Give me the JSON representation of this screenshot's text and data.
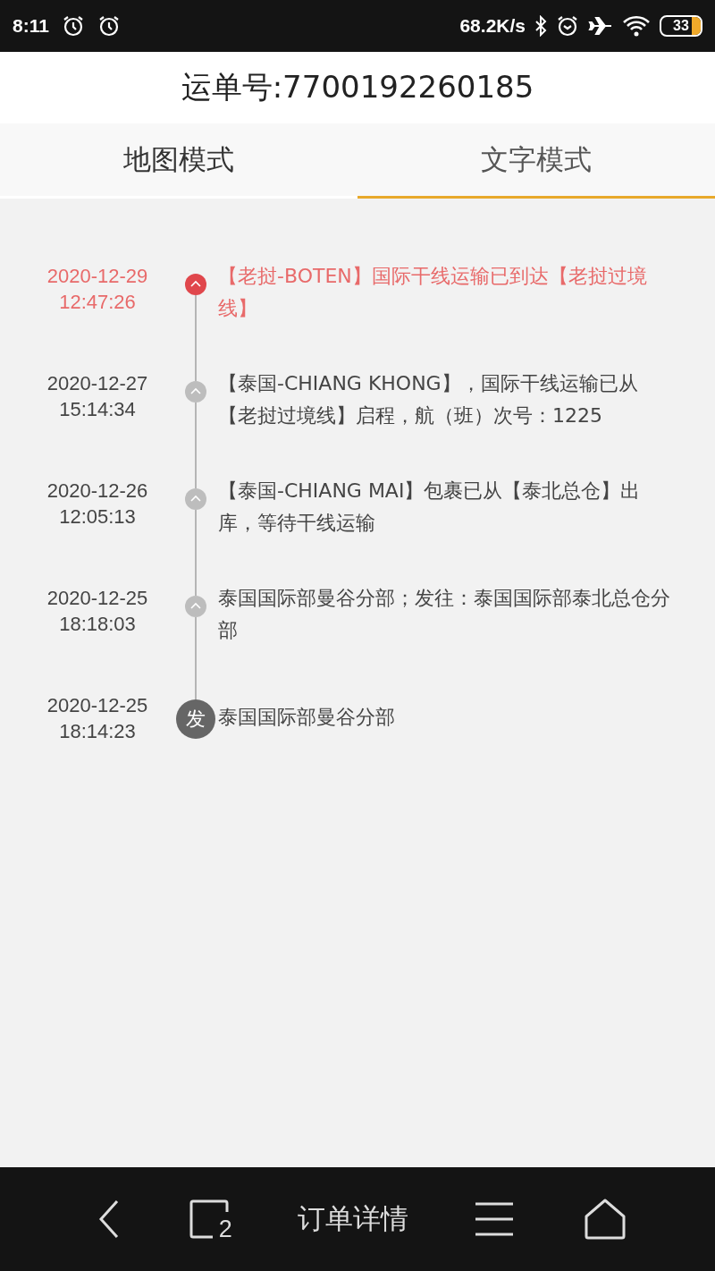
{
  "status_bar": {
    "time": "8:11",
    "speed": "68.2K/s",
    "battery": "33"
  },
  "header": {
    "title": "运单号:7700192260185"
  },
  "tabs": [
    {
      "label": "地图模式",
      "selected": false
    },
    {
      "label": "文字模式",
      "selected": true
    }
  ],
  "timeline": [
    {
      "kind": "latest",
      "date": "2020-12-29",
      "time": "12:47:26",
      "text": "【老挝-BOTEN】国际干线运输已到达【老挝过境线】"
    },
    {
      "kind": "transit",
      "date": "2020-12-27",
      "time": "15:14:34",
      "text": "【泰国-CHIANG KHONG】，国际干线运输已从【老挝过境线】启程，航（班）次号：1225"
    },
    {
      "kind": "transit",
      "date": "2020-12-26",
      "time": "12:05:13",
      "text": "【泰国-CHIANG MAI】包裹已从【泰北总仓】出库，等待干线运输"
    },
    {
      "kind": "transit",
      "date": "2020-12-25",
      "time": "18:18:03",
      "text": "泰国国际部曼谷分部；发往：泰国国际部泰北总仓分部"
    },
    {
      "kind": "origin",
      "date": "2020-12-25",
      "time": "18:14:23",
      "marker": "发",
      "text": "泰国国际部曼谷分部"
    }
  ],
  "bottom_bar": {
    "tab_count": "2",
    "title": "订单详情"
  }
}
